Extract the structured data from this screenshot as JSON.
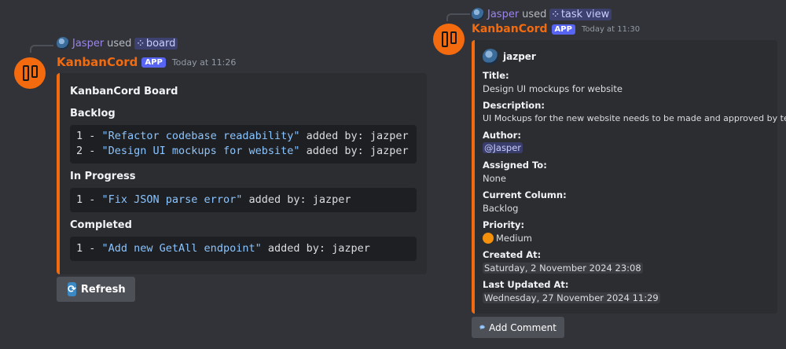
{
  "left_message": {
    "command": {
      "user": "Jasper",
      "used_text": "used",
      "command_name": "board"
    },
    "bot": {
      "name": "KanbanCord",
      "badge": "APP",
      "timestamp": "Today at 11:26"
    },
    "embed": {
      "title": "KanbanCord Board",
      "sections": [
        {
          "heading": "Backlog",
          "items": [
            {
              "index": "1 - ",
              "task": "\"Refactor codebase readability\"",
              "suffix": " added by: jazper"
            },
            {
              "index": "2 - ",
              "task": "\"Design UI mockups for website\"",
              "suffix": " added by: jazper"
            }
          ]
        },
        {
          "heading": "In Progress",
          "items": [
            {
              "index": "1 - ",
              "task": "\"Fix JSON parse error\"",
              "suffix": " added by: jazper"
            }
          ]
        },
        {
          "heading": "Completed",
          "items": [
            {
              "index": "1 - ",
              "task": "\"Add new GetAll endpoint\"",
              "suffix": " added by: jazper"
            }
          ]
        }
      ]
    },
    "button": {
      "label": "Refresh",
      "icon": "refresh-icon"
    }
  },
  "right_message": {
    "command": {
      "user": "Jasper",
      "used_text": "used",
      "command_name": "task view"
    },
    "bot": {
      "name": "KanbanCord",
      "badge": "APP",
      "timestamp": "Today at 11:30"
    },
    "embed": {
      "author": "jazper",
      "fields": {
        "title": {
          "name": "Title:",
          "value": "Design UI mockups for website"
        },
        "description": {
          "name": "Description:",
          "value": "UI Mockups for the new website needs to be made and approved by team."
        },
        "author": {
          "name": "Author:",
          "value": "@Jasper"
        },
        "assigned": {
          "name": "Assigned To:",
          "value": "None"
        },
        "column": {
          "name": "Current Column:",
          "value": "Backlog"
        },
        "priority": {
          "name": "Priority:",
          "value": "Medium"
        },
        "created": {
          "name": "Created At:",
          "value": "Saturday, 2 November 2024 23:08"
        },
        "updated": {
          "name": "Last Updated At:",
          "value": "Wednesday, 27 November 2024 11:29"
        }
      }
    },
    "button": {
      "label": "Add Comment",
      "icon": "speech-bubble-icon"
    }
  },
  "colors": {
    "background": "#323339",
    "embed": "#2b2d31",
    "accent": "#f36b0e",
    "blurple": "#5865f2",
    "code_string": "#8ac4ff"
  }
}
